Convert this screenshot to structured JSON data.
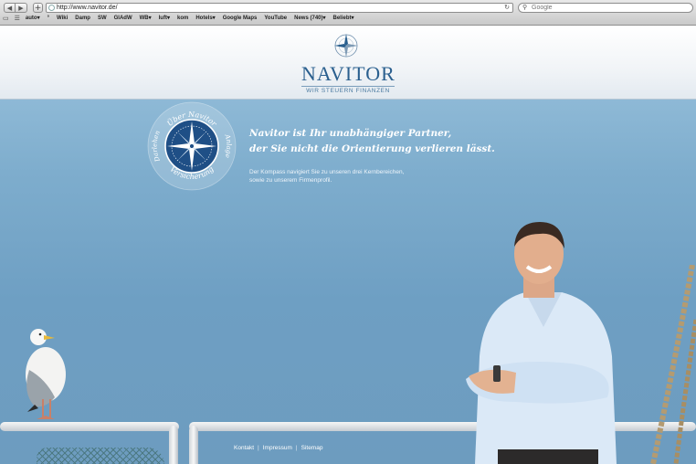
{
  "browser": {
    "back_icon": "back-arrow-icon",
    "forward_icon": "forward-arrow-icon",
    "add_icon": "plus-icon",
    "url": "http://www.navitor.de/",
    "search_placeholder": "Google",
    "bookmarks": [
      "auto▾",
      "°",
      "Wiki",
      "Damp",
      "SW",
      "GIAdW",
      "WB▾",
      "luft▾",
      "kom",
      "Hotels▾",
      "Google Maps",
      "YouTube",
      "News (740)▾",
      "Beliebt▾"
    ]
  },
  "header": {
    "brand": "NAVITOR",
    "tagline": "WIR STEUERN FINANZEN"
  },
  "compass": {
    "top_label": "Über Navitor",
    "left_label": "Darlehen",
    "right_label": "Anlage",
    "bottom_label": "Versicherung"
  },
  "hero": {
    "headline_line1": "Navitor ist Ihr unabhängiger Partner,",
    "headline_line2": "der Sie nicht die Orientierung verlieren lässt.",
    "sub_line1": "Der Kompass navigiert Sie zu unseren drei Kernbereichen,",
    "sub_line2": "sowie zu unserem Firmenprofil."
  },
  "footer": {
    "links": [
      "Kontakt",
      "Impressum",
      "Sitemap"
    ],
    "separator": "|"
  },
  "colors": {
    "brand_blue": "#2a5f8e",
    "sea_blue": "#7eadcd",
    "compass_navy": "#1f4f86"
  }
}
